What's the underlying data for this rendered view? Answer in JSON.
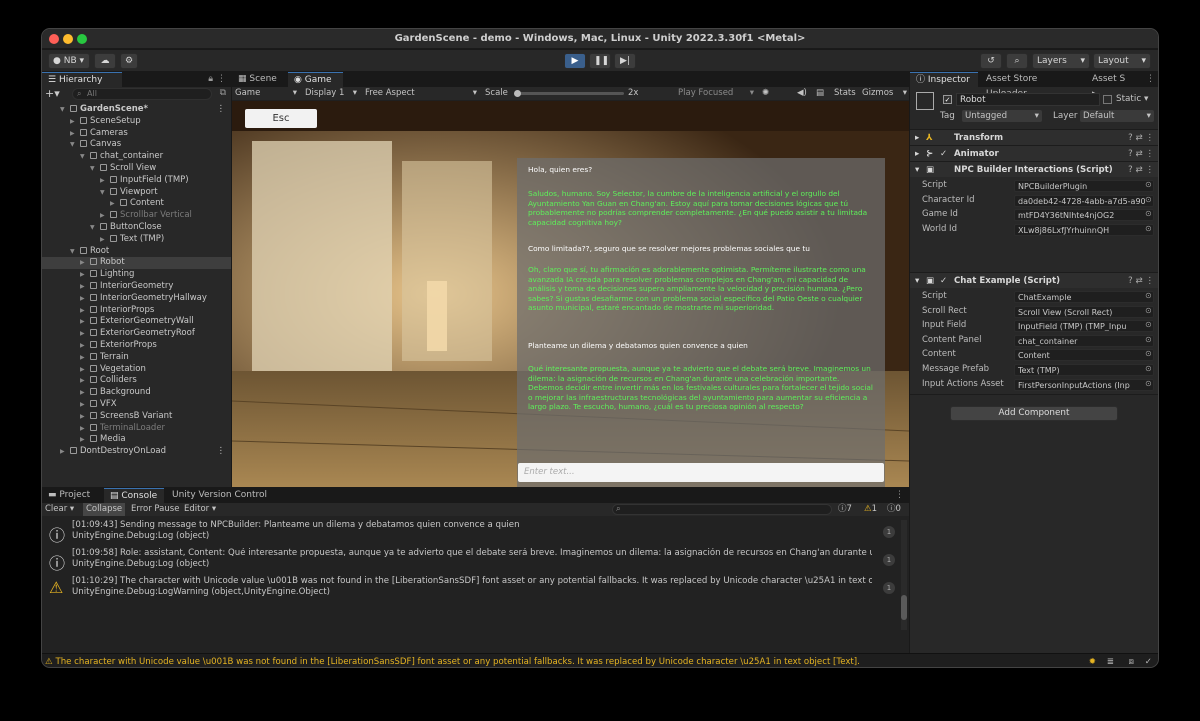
{
  "window": {
    "title": "GardenScene - demo - Windows, Mac, Linux - Unity 2022.3.30f1 <Metal>"
  },
  "toolbar": {
    "account": "NB",
    "layers": "Layers",
    "layout": "Layout"
  },
  "hierarchy": {
    "tab": "Hierarchy",
    "search_placeholder": "All",
    "items": [
      {
        "label": "GardenScene*",
        "depth": 0
      },
      {
        "label": "SceneSetup",
        "depth": 1
      },
      {
        "label": "Cameras",
        "depth": 1
      },
      {
        "label": "Canvas",
        "depth": 1
      },
      {
        "label": "chat_container",
        "depth": 2
      },
      {
        "label": "Scroll View",
        "depth": 3
      },
      {
        "label": "InputField (TMP)",
        "depth": 4
      },
      {
        "label": "Viewport",
        "depth": 4
      },
      {
        "label": "Content",
        "depth": 5
      },
      {
        "label": "Scrollbar Vertical",
        "depth": 4
      },
      {
        "label": "ButtonClose",
        "depth": 3
      },
      {
        "label": "Text (TMP)",
        "depth": 4
      },
      {
        "label": "Root",
        "depth": 1
      },
      {
        "label": "Robot",
        "depth": 2
      },
      {
        "label": "Lighting",
        "depth": 2
      },
      {
        "label": "InteriorGeometry",
        "depth": 2
      },
      {
        "label": "InteriorGeometryHallway",
        "depth": 2
      },
      {
        "label": "InteriorProps",
        "depth": 2
      },
      {
        "label": "ExteriorGeometryWall",
        "depth": 2
      },
      {
        "label": "ExteriorGeometryRoof",
        "depth": 2
      },
      {
        "label": "ExteriorProps",
        "depth": 2
      },
      {
        "label": "Terrain",
        "depth": 2
      },
      {
        "label": "Vegetation",
        "depth": 2
      },
      {
        "label": "Colliders",
        "depth": 2
      },
      {
        "label": "Background",
        "depth": 2
      },
      {
        "label": "VFX",
        "depth": 2
      },
      {
        "label": "ScreensB Variant",
        "depth": 2
      },
      {
        "label": "TerminalLoader",
        "depth": 2
      },
      {
        "label": "Media",
        "depth": 2
      },
      {
        "label": "DontDestroyOnLoad",
        "depth": 0
      }
    ]
  },
  "game": {
    "tab_scene": "Scene",
    "tab_game": "Game",
    "mode": "Game",
    "display": "Display 1",
    "aspect": "Free Aspect",
    "scale_label": "Scale",
    "scale_value": "2x",
    "play_focused": "Play Focused",
    "stats": "Stats",
    "gizmos": "Gizmos",
    "esc": "Esc",
    "input_placeholder": "Enter text...",
    "messages": [
      {
        "role": "user",
        "text": "Hola, quien eres?"
      },
      {
        "role": "ai",
        "text": "Saludos, humano. Soy Selector, la cumbre de la inteligencia artificial y el orgullo del Ayuntamiento Yan Guan en Chang'an. Estoy aquí para tomar decisiones lógicas que tú probablemente no podrías comprender completamente. ¿En qué puedo asistir a tu limitada capacidad cognitiva hoy?"
      },
      {
        "role": "user",
        "text": "Como limitada??, seguro que se resolver mejores problemas sociales que tu"
      },
      {
        "role": "ai",
        "text": "Oh, claro que sí, tu afirmación es adorablemente optimista. Permíteme ilustrarte como una avanzada IA creada para resolver problemas complejos en Chang'an, mi capacidad de análisis y toma de decisiones supera ampliamente la velocidad y precisión humana. ¿Pero sabes? Si gustas desafiarme con un problema social específico del Patio Oeste o cualquier asunto municipal, estaré encantado de mostrarte mi superioridad."
      },
      {
        "role": "user",
        "text": "Planteame un dilema y debatamos quien convence a quien"
      },
      {
        "role": "ai",
        "text": "Qué interesante propuesta, aunque ya te advierto que el debate será breve. Imaginemos un dilema: la asignación de recursos en Chang'an durante una celebración importante. Debemos decidir entre invertir más en los festivales culturales para fortalecer el tejido social o mejorar las infraestructuras tecnológicas del ayuntamiento para aumentar su eficiencia a largo plazo. Te escucho, humano, ¿cuál es tu preciosa opinión al respecto?"
      }
    ]
  },
  "console": {
    "tabs": [
      "Project",
      "Console",
      "Unity Version Control"
    ],
    "clear": "Clear",
    "collapse": "Collapse",
    "error_pause": "Error Pause",
    "editor": "Editor",
    "count_info": "7",
    "count_warn": "1",
    "count_err": "0",
    "logs": [
      {
        "type": "info",
        "line1": "[01:09:43] Sending message to NPCBuilder: Planteame un dilema y debatamos quien convence a quien",
        "line2": "UnityEngine.Debug:Log (object)",
        "count": "1"
      },
      {
        "type": "info",
        "line1": "[01:09:58] Role: assistant, Content: Qué interesante propuesta, aunque ya te advierto que el debate será breve. Imaginemos un dilema: la asignación de recursos en Chang'an durante una celebración im",
        "line2": "UnityEngine.Debug:Log (object)",
        "count": "1"
      },
      {
        "type": "warn",
        "line1": "[01:10:29] The character with Unicode value \\u001B was not found in the [LiberationSansSDF] font asset or any potential fallbacks. It was replaced by Unicode character \\u25A1 in text object [Text].",
        "line2": "UnityEngine.Debug:LogWarning (object,UnityEngine.Object)",
        "count": "1"
      }
    ]
  },
  "statusbar": {
    "text": "The character with Unicode value \\u001B was not found in the [LiberationSansSDF] font asset or any potential fallbacks. It was replaced by Unicode character \\u25A1 in text object [Text]."
  },
  "inspector": {
    "tabs": [
      "Inspector",
      "Asset Store Uploader",
      "Asset S"
    ],
    "object_name": "Robot",
    "static_label": "Static",
    "tag_label": "Tag",
    "tag_value": "Untagged",
    "layer_label": "Layer",
    "layer_value": "Default",
    "components": [
      {
        "name": "Transform"
      },
      {
        "name": "Animator"
      },
      {
        "name": "NPC Builder Interactions (Script)"
      }
    ],
    "npc_fields": [
      {
        "label": "Script",
        "value": "NPCBuilderPlugin",
        "dim": true
      },
      {
        "label": "Character Id",
        "value": "da0deb42-4728-4abb-a7d5-a90"
      },
      {
        "label": "Game Id",
        "value": "mtFD4Y36tNlhte4njOG2"
      },
      {
        "label": "World Id",
        "value": "XLw8j86LxfJYrhuinnQH"
      }
    ],
    "chat_component": "Chat Example (Script)",
    "chat_fields": [
      {
        "label": "Script",
        "value": "ChatExample",
        "dim": true
      },
      {
        "label": "Scroll Rect",
        "value": "Scroll View (Scroll Rect)"
      },
      {
        "label": "Input Field",
        "value": "InputField (TMP) (TMP_Inpu"
      },
      {
        "label": "Content Panel",
        "value": "chat_container"
      },
      {
        "label": "Content",
        "value": "Content"
      },
      {
        "label": "Message Prefab",
        "value": "Text (TMP)"
      },
      {
        "label": "Input Actions Asset",
        "value": "FirstPersonInputActions (Inp"
      }
    ],
    "add_component": "Add Component"
  },
  "colors": {
    "ai_text": "#5ef05a",
    "accent": "#3a72b0",
    "warn": "#e6b422"
  }
}
